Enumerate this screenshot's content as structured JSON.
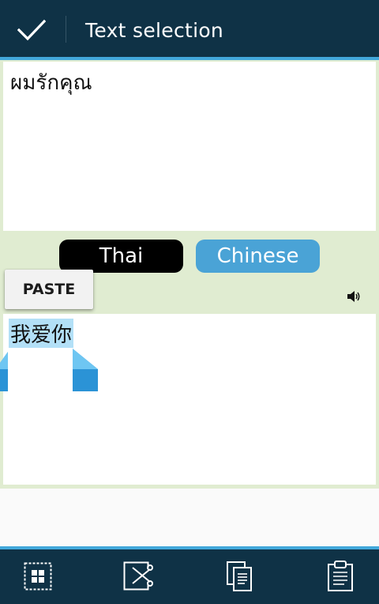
{
  "header": {
    "title": "Text selection",
    "done_icon": "checkmark-icon"
  },
  "source": {
    "text": "ผมรักคุณ"
  },
  "languages": {
    "source_label": "Thai",
    "target_label": "Chinese"
  },
  "target": {
    "text": "我爱你",
    "speaker_icon": "speaker-icon"
  },
  "context_menu": {
    "paste_label": "PASTE"
  },
  "bottom_bar": {
    "icons": [
      "select-all-icon",
      "cut-icon",
      "copy-icon",
      "paste-icon"
    ]
  },
  "colors": {
    "bar_background": "#0f3246",
    "accent": "#42a8db",
    "content_background": "#e0ecd1",
    "selected_language": "#000000",
    "other_language": "#4aa3d6",
    "selection_highlight": "#b3e0f7",
    "handle": "#2b93d6"
  }
}
